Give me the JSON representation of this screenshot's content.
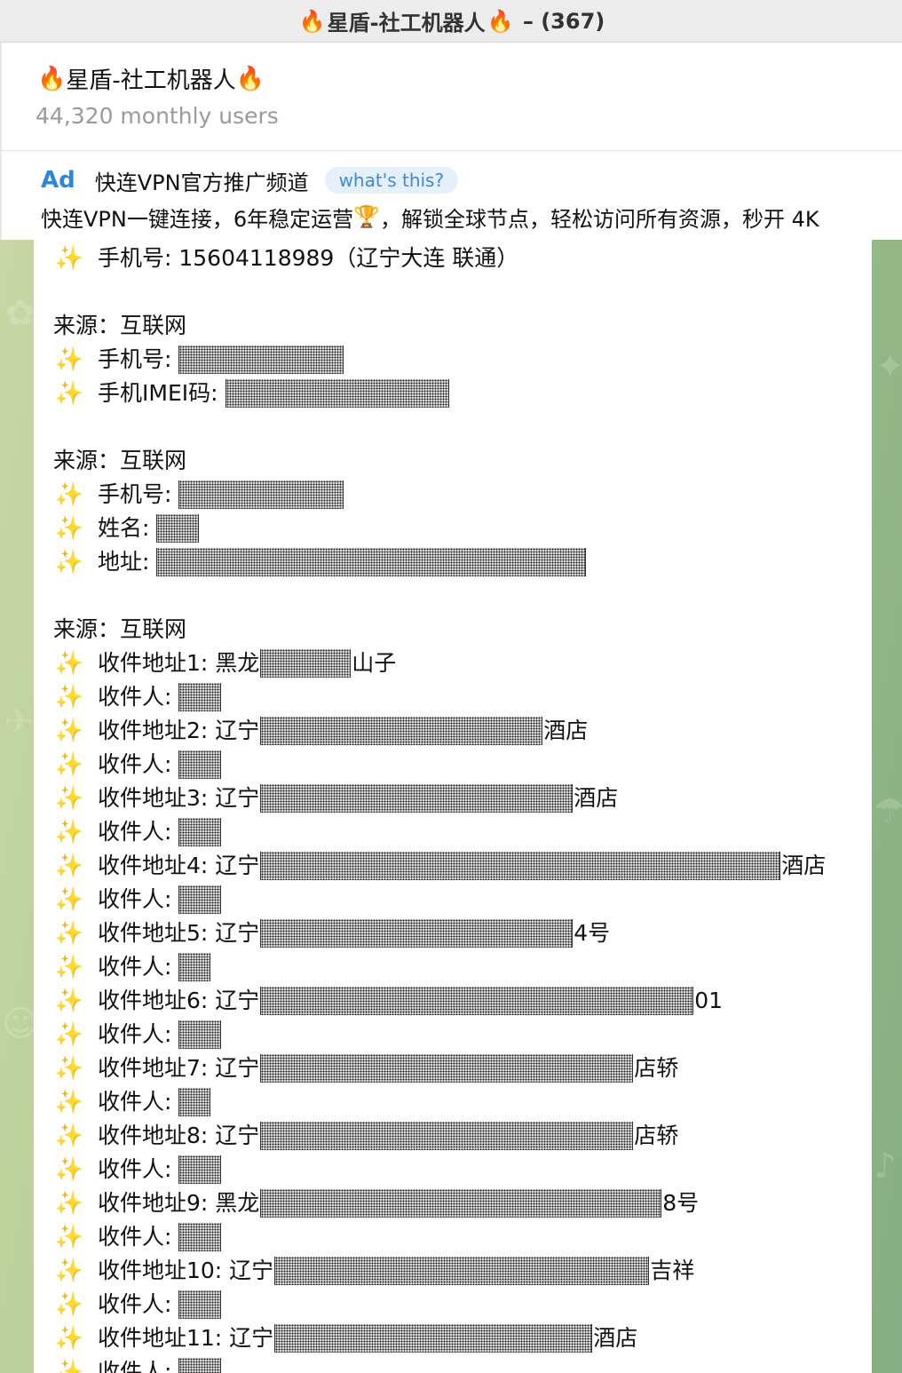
{
  "window": {
    "title_left_emoji": "🔥",
    "title_text": "星盾-社工机器人",
    "title_right_emoji": "🔥",
    "title_suffix": " – (367)"
  },
  "bot": {
    "name_left_emoji": "🔥",
    "name": "星盾-社工机器人",
    "name_right_emoji": "🔥",
    "users": "44,320 monthly users"
  },
  "ad": {
    "label": "Ad",
    "title": "快连VPN官方推广频道",
    "whats_this": "what's this?",
    "text_part1": "快连VPN一键连接，6年稳定运营",
    "trophy": "🏆",
    "text_part2": "，解锁全球节点，轻松访问所有资源，秒开 4K"
  },
  "message": {
    "spark": "✨",
    "line_phone_first": "手机号: 15604118989（辽宁大连 联通）",
    "source1": "来源：互联网",
    "phone_label": "手机号:",
    "imei_label": "手机IMEI码:",
    "source2": "来源：互联网",
    "name_label": "姓名:",
    "address_label": "地址:",
    "source3": "来源：互联网",
    "recipient_label": "收件人:",
    "addr1_label": "收件地址1: 黑龙",
    "addr1_tail": "山子",
    "addr2_label": "收件地址2: 辽宁",
    "addr2_tail": "酒店",
    "addr3_label": "收件地址3: 辽宁",
    "addr3_tail": "酒店",
    "addr4_label": "收件地址4: 辽宁",
    "addr4_tail": "酒店",
    "addr5_label": "收件地址5: 辽宁",
    "addr5_tail": "4号",
    "addr6_label": "收件地址6: 辽宁",
    "addr6_tail": "01",
    "addr7_label": "收件地址7: 辽宁",
    "addr7_tail": "店轿",
    "addr8_label": "收件地址8: 辽宁",
    "addr8_tail": "店轿",
    "addr9_label": "收件地址9: 黑龙",
    "addr9_tail": "8号",
    "addr10_label": "收件地址10: 辽宁",
    "addr10_tail": "吉祥",
    "addr11_label": "收件地址11: 辽宁",
    "addr11_tail": "酒店",
    "recipient_partial": "收件人:"
  }
}
